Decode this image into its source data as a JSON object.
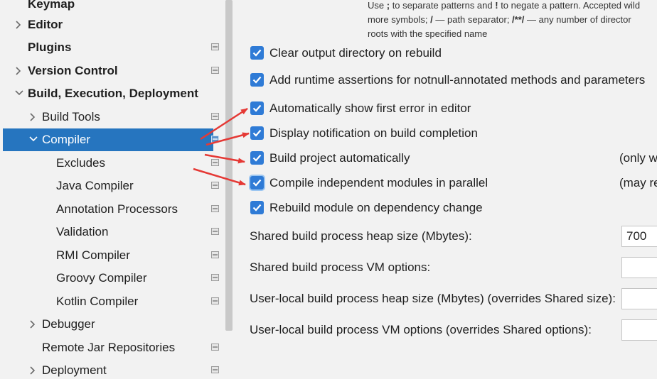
{
  "sidebar": {
    "items": [
      {
        "label": "Keymap",
        "indent": 0,
        "chevron": "none",
        "bold": true,
        "icon": false,
        "selected": false
      },
      {
        "label": "Editor",
        "indent": 0,
        "chevron": "right",
        "bold": true,
        "icon": false,
        "selected": false
      },
      {
        "label": "Plugins",
        "indent": 0,
        "chevron": "none",
        "bold": true,
        "icon": true,
        "selected": false
      },
      {
        "label": "Version Control",
        "indent": 0,
        "chevron": "right",
        "bold": true,
        "icon": true,
        "selected": false
      },
      {
        "label": "Build, Execution, Deployment",
        "indent": 0,
        "chevron": "down",
        "bold": true,
        "icon": false,
        "selected": false
      },
      {
        "label": "Build Tools",
        "indent": 1,
        "chevron": "right",
        "bold": false,
        "icon": true,
        "selected": false
      },
      {
        "label": "Compiler",
        "indent": 1,
        "chevron": "down",
        "bold": false,
        "icon": true,
        "selected": true
      },
      {
        "label": "Excludes",
        "indent": 2,
        "chevron": "none",
        "bold": false,
        "icon": true,
        "selected": false
      },
      {
        "label": "Java Compiler",
        "indent": 2,
        "chevron": "none",
        "bold": false,
        "icon": true,
        "selected": false
      },
      {
        "label": "Annotation Processors",
        "indent": 2,
        "chevron": "none",
        "bold": false,
        "icon": true,
        "selected": false
      },
      {
        "label": "Validation",
        "indent": 2,
        "chevron": "none",
        "bold": false,
        "icon": true,
        "selected": false
      },
      {
        "label": "RMI Compiler",
        "indent": 2,
        "chevron": "none",
        "bold": false,
        "icon": true,
        "selected": false
      },
      {
        "label": "Groovy Compiler",
        "indent": 2,
        "chevron": "none",
        "bold": false,
        "icon": true,
        "selected": false
      },
      {
        "label": "Kotlin Compiler",
        "indent": 2,
        "chevron": "none",
        "bold": false,
        "icon": true,
        "selected": false
      },
      {
        "label": "Debugger",
        "indent": 1,
        "chevron": "right",
        "bold": false,
        "icon": false,
        "selected": false
      },
      {
        "label": "Remote Jar Repositories",
        "indent": 1,
        "chevron": "none",
        "bold": false,
        "icon": true,
        "selected": false
      },
      {
        "label": "Deployment",
        "indent": 1,
        "chevron": "right",
        "bold": false,
        "icon": true,
        "selected": false
      }
    ]
  },
  "hint": {
    "line1_a": "Use ",
    "line1_b": ";",
    "line1_c": " to separate patterns and ",
    "line1_d": "!",
    "line1_e": " to negate a pattern. Accepted wild",
    "line2_a": "more symbols; ",
    "line2_b": "/",
    "line2_c": " — path separator; ",
    "line2_d": "/**/",
    "line2_e": " — any number of director",
    "line3": "roots with the specified name"
  },
  "options": [
    {
      "label": "Clear output directory on rebuild",
      "checked": true,
      "note": ""
    },
    {
      "label": "Add runtime assertions for notnull-annotated methods and parameters",
      "checked": true,
      "note": ""
    },
    {
      "label": "Automatically show first error in editor",
      "checked": true,
      "note": ""
    },
    {
      "label": "Display notification on build completion",
      "checked": true,
      "note": ""
    },
    {
      "label": "Build project automatically",
      "checked": true,
      "note": "(only w"
    },
    {
      "label": "Compile independent modules in parallel",
      "checked": true,
      "note": "(may re"
    },
    {
      "label": "Rebuild module on dependency change",
      "checked": true,
      "note": ""
    }
  ],
  "fields": [
    {
      "label": "Shared build process heap size (Mbytes):",
      "value": "700"
    },
    {
      "label": "Shared build process VM options:",
      "value": ""
    },
    {
      "label": "User-local build process heap size (Mbytes) (overrides Shared size):",
      "value": ""
    },
    {
      "label": "User-local build process VM options (overrides Shared options):",
      "value": ""
    }
  ],
  "colors": {
    "selection": "#2675bf",
    "checkbox": "#2f7bd6",
    "annotation_arrow": "#e53935"
  }
}
